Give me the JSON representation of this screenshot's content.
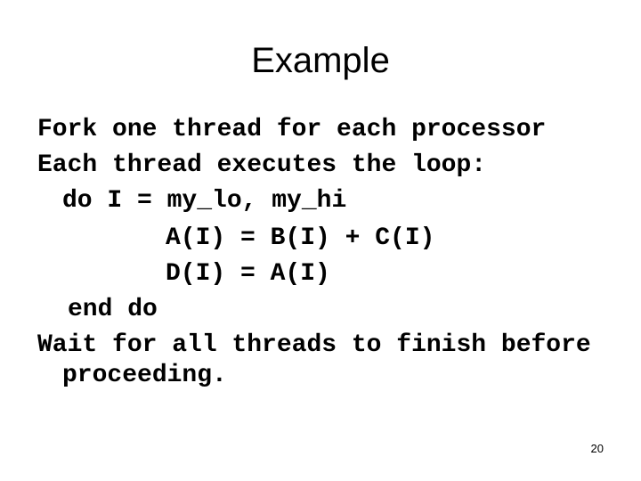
{
  "slide": {
    "title": "Example",
    "lines": [
      "Fork one thread for each processor",
      "Each thread executes the loop:",
      "do I = my_lo, my_hi",
      "A(I) = B(I) + C(I)",
      "D(I) = A(I)",
      "end do",
      "Wait for all threads to finish before",
      "proceeding."
    ],
    "page_number": "20"
  }
}
